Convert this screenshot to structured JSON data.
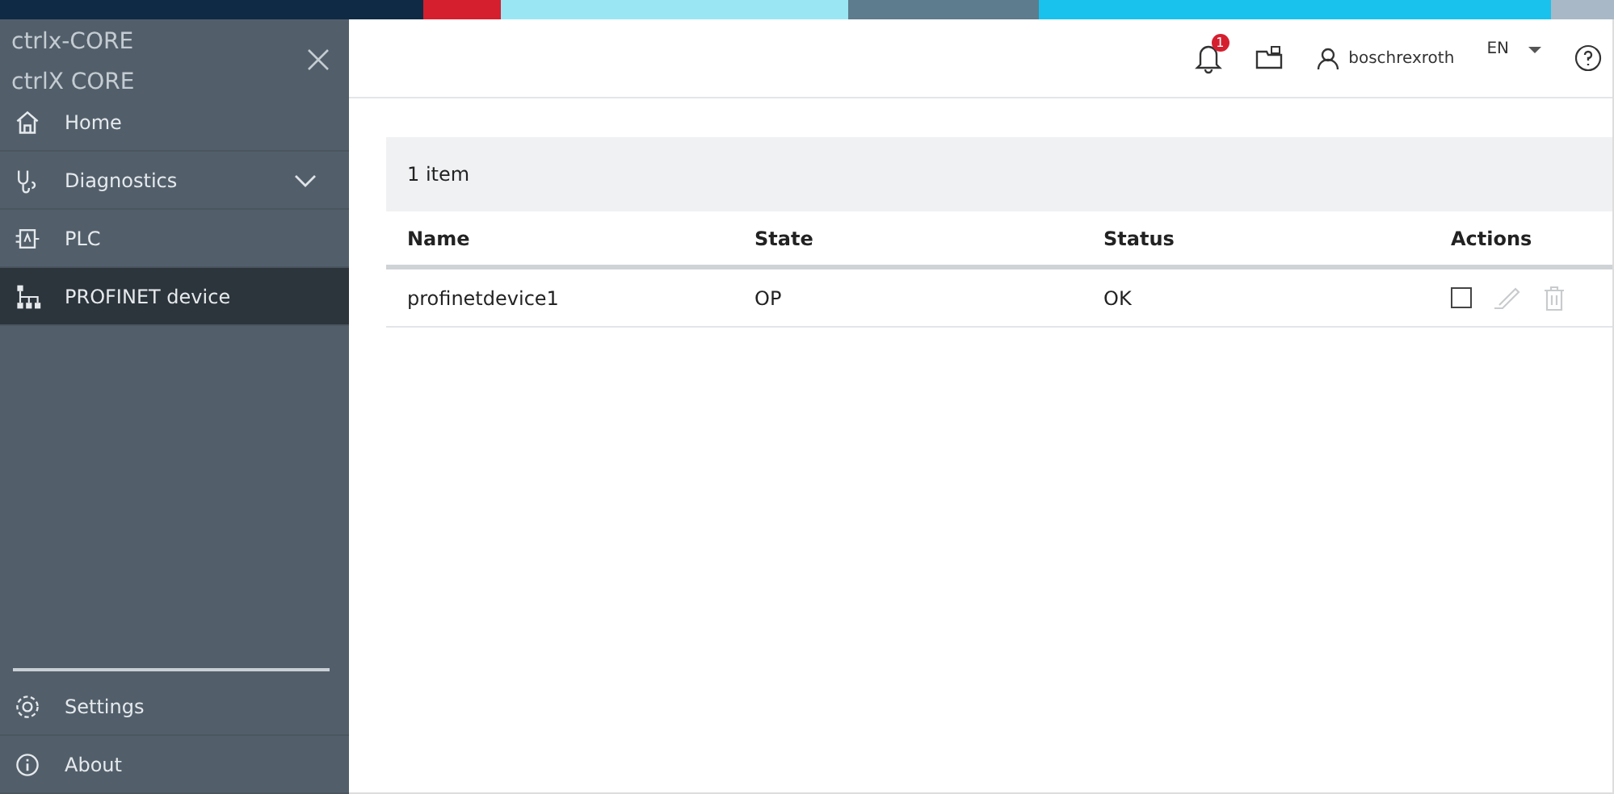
{
  "top_strip": [
    {
      "color": "#0f2a44"
    },
    {
      "color": "#d51f2f"
    },
    {
      "color": "#9be6f3"
    },
    {
      "color": "#5d7c8d"
    },
    {
      "color": "#19c2ec"
    },
    {
      "color": "#a8b8c6"
    }
  ],
  "sidebar": {
    "device_name": "ctrlx-CORE",
    "device_type": "ctrlX CORE",
    "items": [
      {
        "label": "Home",
        "kind": "link",
        "selected": false
      },
      {
        "label": "Diagnostics",
        "kind": "group",
        "expanded": false,
        "selected": false
      },
      {
        "label": "PLC",
        "kind": "link",
        "selected": false
      },
      {
        "label": "PROFINET device",
        "kind": "link",
        "selected": true
      }
    ],
    "bottom_items": [
      {
        "label": "Settings"
      },
      {
        "label": "About"
      }
    ]
  },
  "header": {
    "notification_count": "1",
    "user": "boschrexroth",
    "language": "EN"
  },
  "table": {
    "count": "1 item",
    "columns": [
      "Name",
      "State",
      "Status",
      "Actions"
    ],
    "rows": [
      {
        "name": "profinetdevice1",
        "state": "OP",
        "status": "OK",
        "checked": false,
        "edit_disabled": true,
        "delete_disabled": true
      }
    ]
  }
}
